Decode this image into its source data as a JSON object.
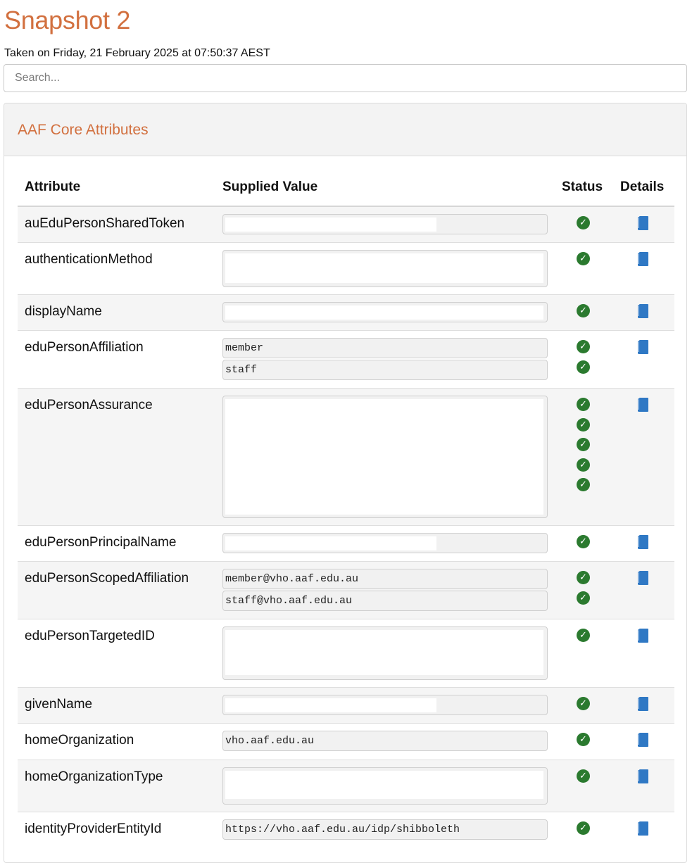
{
  "page": {
    "title": "Snapshot 2",
    "taken": "Taken on Friday, 21 February 2025 at 07:50:37 AEST",
    "search_placeholder": "Search..."
  },
  "panel": {
    "title": "AAF Core Attributes",
    "columns": [
      "Attribute",
      "Supplied Value",
      "Status",
      "Details"
    ]
  },
  "rows": [
    {
      "name": "auEduPersonSharedToken",
      "values": [
        ""
      ]
    },
    {
      "name": "authenticationMethod",
      "values": [
        ""
      ]
    },
    {
      "name": "displayName",
      "values": [
        ""
      ]
    },
    {
      "name": "eduPersonAffiliation",
      "values": [
        "member",
        "staff"
      ]
    },
    {
      "name": "eduPersonAssurance",
      "values": [
        "",
        "",
        "",
        "",
        ""
      ]
    },
    {
      "name": "eduPersonPrincipalName",
      "values": [
        ""
      ]
    },
    {
      "name": "eduPersonScopedAffiliation",
      "values": [
        "member@vho.aaf.edu.au",
        "staff@vho.aaf.edu.au"
      ]
    },
    {
      "name": "eduPersonTargetedID",
      "values": [
        ""
      ]
    },
    {
      "name": "givenName",
      "values": [
        ""
      ]
    },
    {
      "name": "homeOrganization",
      "values": [
        "vho.aaf.edu.au"
      ]
    },
    {
      "name": "homeOrganizationType",
      "values": [
        ""
      ]
    },
    {
      "name": "identityProviderEntityId",
      "values": [
        "https://vho.aaf.edu.au/idp/shibboleth"
      ]
    }
  ],
  "icons": {
    "status": "check-circle-icon",
    "details": "book-icon",
    "status_color": "#2b7a2f",
    "details_color": "#2f78c4",
    "accent": "#d2703f"
  }
}
